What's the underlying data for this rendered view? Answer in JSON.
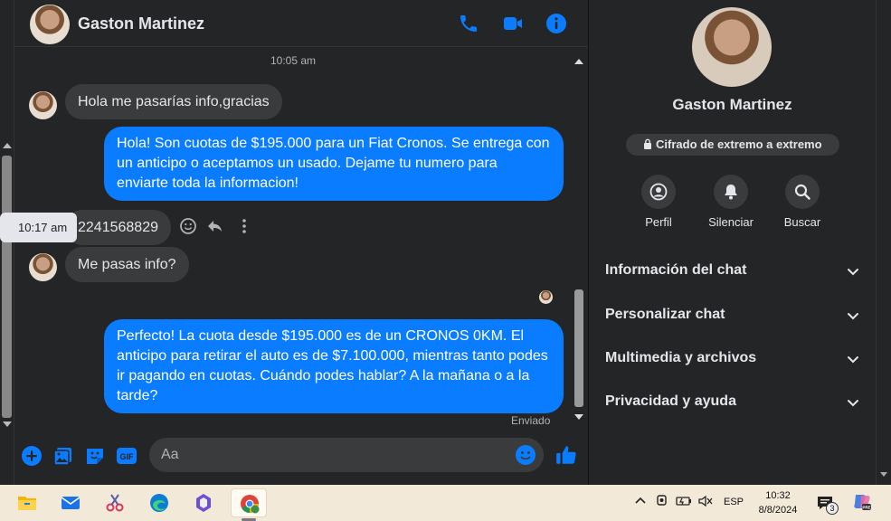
{
  "chat": {
    "contact_name": "Gaston Martinez",
    "timestamp": "10:05 am",
    "messages": [
      {
        "from": "them",
        "text": "Hola me pasarías info,gracias"
      },
      {
        "from": "me",
        "text": "Hola! Son cuotas de $195.000 para un Fiat Cronos. Se entrega con un anticipo o aceptamos un usado. Dejame tu numero para enviarte toda la informacion!"
      },
      {
        "from": "them",
        "text": "2241568829"
      },
      {
        "from": "them",
        "text": "Me pasas info?"
      },
      {
        "from": "me",
        "text": "Perfecto! La cuota desde $195.000 es de un CRONOS 0KM. El anticipo para retirar el auto es de $7.100.000, mientras tanto podes ir pagando en cuotas. Cuándo podes hablar? A la mañana o a la tarde?"
      }
    ],
    "hover_tooltip": "10:17 am",
    "status": "Enviado",
    "composer_placeholder": "Aa"
  },
  "info": {
    "name": "Gaston Martinez",
    "e2e_label": "Cifrado de extremo a extremo",
    "actions": [
      {
        "label": "Perfil",
        "icon": "profile-icon"
      },
      {
        "label": "Silenciar",
        "icon": "bell-icon"
      },
      {
        "label": "Buscar",
        "icon": "search-icon"
      }
    ],
    "sections": [
      {
        "label": "Información del chat"
      },
      {
        "label": "Personalizar chat"
      },
      {
        "label": "Multimedia y archivos"
      },
      {
        "label": "Privacidad y ayuda"
      }
    ]
  },
  "taskbar": {
    "apps": [
      "file-explorer-icon",
      "mail-icon",
      "snipping-tool-icon",
      "edge-icon",
      "copilot-icon",
      "chrome-icon"
    ],
    "active_app": "chrome-icon",
    "language": "ESP",
    "time": "10:32",
    "date": "8/8/2024",
    "notification_count": "3"
  },
  "colors": {
    "accent": "#0a7cff",
    "panel_bg": "#242526",
    "bubble_in": "#3a3b3c",
    "taskbar_bg": "#f3e9d9"
  }
}
